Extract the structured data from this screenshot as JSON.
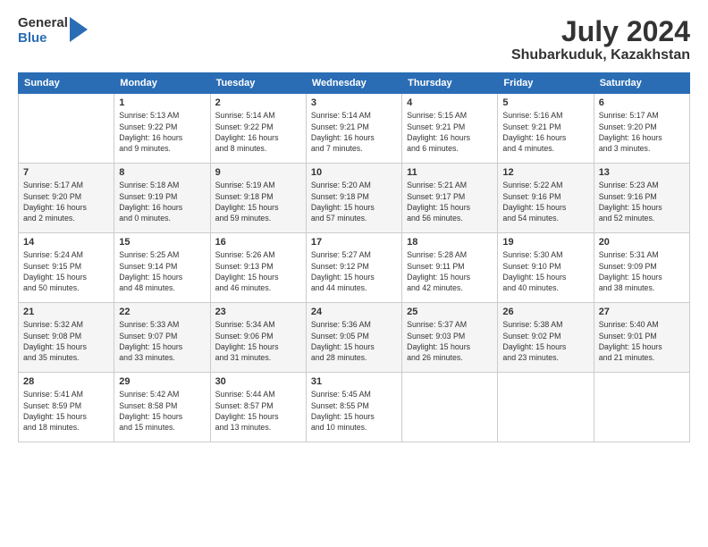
{
  "logo": {
    "general": "General",
    "blue": "Blue"
  },
  "title": "July 2024",
  "subtitle": "Shubarkuduk, Kazakhstan",
  "weekdays": [
    "Sunday",
    "Monday",
    "Tuesday",
    "Wednesday",
    "Thursday",
    "Friday",
    "Saturday"
  ],
  "weeks": [
    [
      {
        "day": "",
        "info": ""
      },
      {
        "day": "1",
        "info": "Sunrise: 5:13 AM\nSunset: 9:22 PM\nDaylight: 16 hours\nand 9 minutes."
      },
      {
        "day": "2",
        "info": "Sunrise: 5:14 AM\nSunset: 9:22 PM\nDaylight: 16 hours\nand 8 minutes."
      },
      {
        "day": "3",
        "info": "Sunrise: 5:14 AM\nSunset: 9:21 PM\nDaylight: 16 hours\nand 7 minutes."
      },
      {
        "day": "4",
        "info": "Sunrise: 5:15 AM\nSunset: 9:21 PM\nDaylight: 16 hours\nand 6 minutes."
      },
      {
        "day": "5",
        "info": "Sunrise: 5:16 AM\nSunset: 9:21 PM\nDaylight: 16 hours\nand 4 minutes."
      },
      {
        "day": "6",
        "info": "Sunrise: 5:17 AM\nSunset: 9:20 PM\nDaylight: 16 hours\nand 3 minutes."
      }
    ],
    [
      {
        "day": "7",
        "info": "Sunrise: 5:17 AM\nSunset: 9:20 PM\nDaylight: 16 hours\nand 2 minutes."
      },
      {
        "day": "8",
        "info": "Sunrise: 5:18 AM\nSunset: 9:19 PM\nDaylight: 16 hours\nand 0 minutes."
      },
      {
        "day": "9",
        "info": "Sunrise: 5:19 AM\nSunset: 9:18 PM\nDaylight: 15 hours\nand 59 minutes."
      },
      {
        "day": "10",
        "info": "Sunrise: 5:20 AM\nSunset: 9:18 PM\nDaylight: 15 hours\nand 57 minutes."
      },
      {
        "day": "11",
        "info": "Sunrise: 5:21 AM\nSunset: 9:17 PM\nDaylight: 15 hours\nand 56 minutes."
      },
      {
        "day": "12",
        "info": "Sunrise: 5:22 AM\nSunset: 9:16 PM\nDaylight: 15 hours\nand 54 minutes."
      },
      {
        "day": "13",
        "info": "Sunrise: 5:23 AM\nSunset: 9:16 PM\nDaylight: 15 hours\nand 52 minutes."
      }
    ],
    [
      {
        "day": "14",
        "info": "Sunrise: 5:24 AM\nSunset: 9:15 PM\nDaylight: 15 hours\nand 50 minutes."
      },
      {
        "day": "15",
        "info": "Sunrise: 5:25 AM\nSunset: 9:14 PM\nDaylight: 15 hours\nand 48 minutes."
      },
      {
        "day": "16",
        "info": "Sunrise: 5:26 AM\nSunset: 9:13 PM\nDaylight: 15 hours\nand 46 minutes."
      },
      {
        "day": "17",
        "info": "Sunrise: 5:27 AM\nSunset: 9:12 PM\nDaylight: 15 hours\nand 44 minutes."
      },
      {
        "day": "18",
        "info": "Sunrise: 5:28 AM\nSunset: 9:11 PM\nDaylight: 15 hours\nand 42 minutes."
      },
      {
        "day": "19",
        "info": "Sunrise: 5:30 AM\nSunset: 9:10 PM\nDaylight: 15 hours\nand 40 minutes."
      },
      {
        "day": "20",
        "info": "Sunrise: 5:31 AM\nSunset: 9:09 PM\nDaylight: 15 hours\nand 38 minutes."
      }
    ],
    [
      {
        "day": "21",
        "info": "Sunrise: 5:32 AM\nSunset: 9:08 PM\nDaylight: 15 hours\nand 35 minutes."
      },
      {
        "day": "22",
        "info": "Sunrise: 5:33 AM\nSunset: 9:07 PM\nDaylight: 15 hours\nand 33 minutes."
      },
      {
        "day": "23",
        "info": "Sunrise: 5:34 AM\nSunset: 9:06 PM\nDaylight: 15 hours\nand 31 minutes."
      },
      {
        "day": "24",
        "info": "Sunrise: 5:36 AM\nSunset: 9:05 PM\nDaylight: 15 hours\nand 28 minutes."
      },
      {
        "day": "25",
        "info": "Sunrise: 5:37 AM\nSunset: 9:03 PM\nDaylight: 15 hours\nand 26 minutes."
      },
      {
        "day": "26",
        "info": "Sunrise: 5:38 AM\nSunset: 9:02 PM\nDaylight: 15 hours\nand 23 minutes."
      },
      {
        "day": "27",
        "info": "Sunrise: 5:40 AM\nSunset: 9:01 PM\nDaylight: 15 hours\nand 21 minutes."
      }
    ],
    [
      {
        "day": "28",
        "info": "Sunrise: 5:41 AM\nSunset: 8:59 PM\nDaylight: 15 hours\nand 18 minutes."
      },
      {
        "day": "29",
        "info": "Sunrise: 5:42 AM\nSunset: 8:58 PM\nDaylight: 15 hours\nand 15 minutes."
      },
      {
        "day": "30",
        "info": "Sunrise: 5:44 AM\nSunset: 8:57 PM\nDaylight: 15 hours\nand 13 minutes."
      },
      {
        "day": "31",
        "info": "Sunrise: 5:45 AM\nSunset: 8:55 PM\nDaylight: 15 hours\nand 10 minutes."
      },
      {
        "day": "",
        "info": ""
      },
      {
        "day": "",
        "info": ""
      },
      {
        "day": "",
        "info": ""
      }
    ]
  ]
}
